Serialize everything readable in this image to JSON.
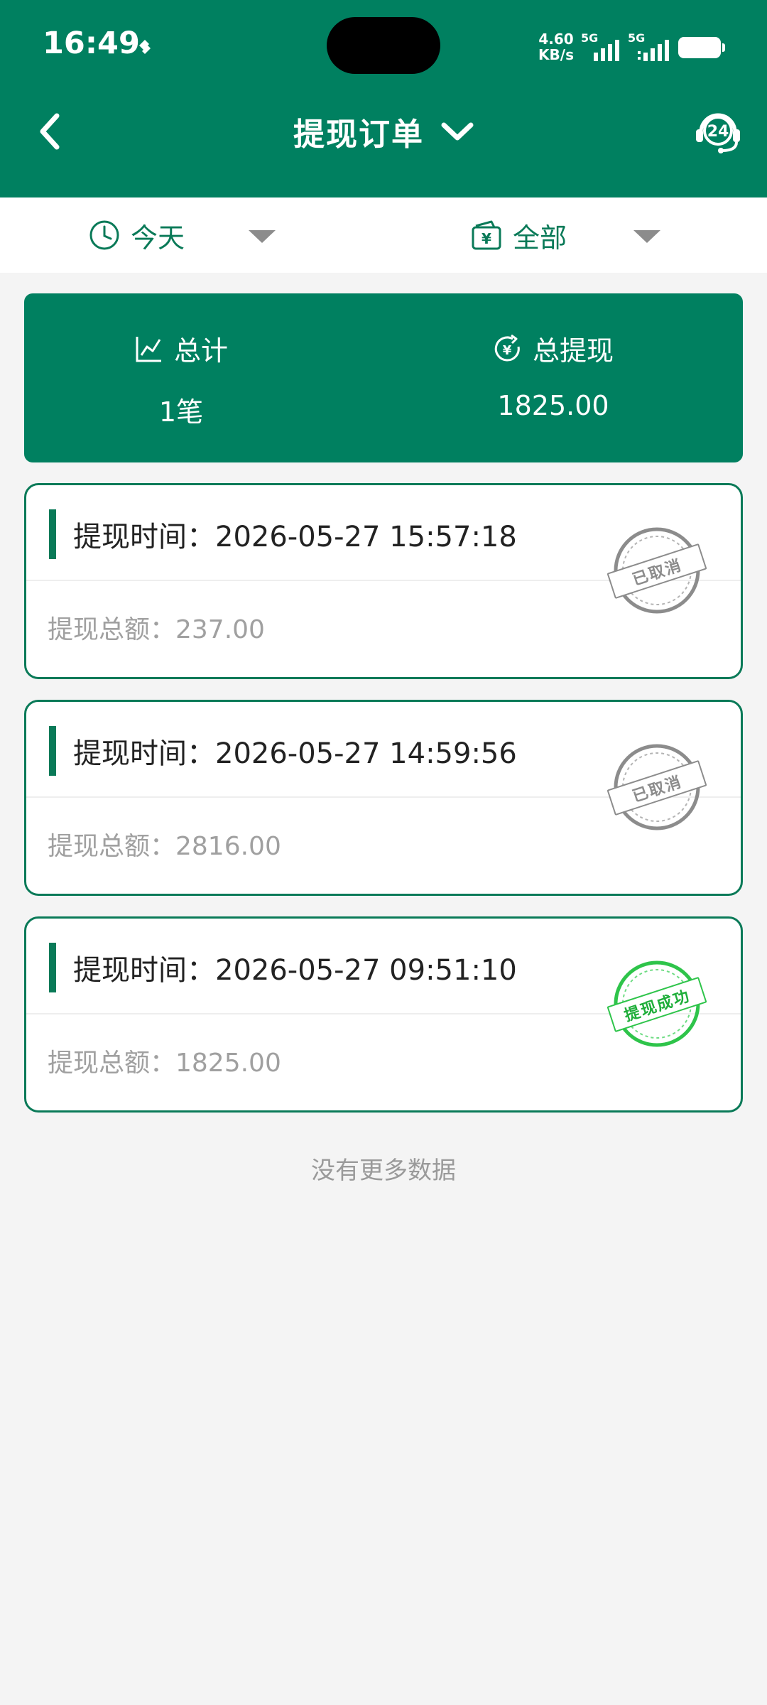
{
  "status_bar": {
    "time": "16:49",
    "net_speed_value": "4.60",
    "net_speed_unit": "KB/s",
    "signal1_tag": "5G",
    "signal2_tag": "5G"
  },
  "nav": {
    "title": "提现订单",
    "support_badge": "24"
  },
  "filters": {
    "date_label": "今天",
    "type_label": "全部"
  },
  "summary": {
    "total_label": "总计",
    "total_value": "1笔",
    "withdraw_label": "总提现",
    "withdraw_value": "1825.00"
  },
  "orders": [
    {
      "time": "提现时间：2026-05-27 15:57:18",
      "amount": "提现总额：237.00",
      "stamp": "已取消",
      "stamp_color": "#8c8c8c"
    },
    {
      "time": "提现时间：2026-05-27 14:59:56",
      "amount": "提现总额：2816.00",
      "stamp": "已取消",
      "stamp_color": "#8c8c8c"
    },
    {
      "time": "提现时间：2026-05-27 09:51:10",
      "amount": "提现总额：1825.00",
      "stamp": "提现成功",
      "stamp_color": "#1fae3a"
    }
  ],
  "footer": {
    "no_more": "没有更多数据"
  },
  "colors": {
    "primary": "#008060",
    "accent": "#0a7a58",
    "background": "#f4f4f4"
  }
}
